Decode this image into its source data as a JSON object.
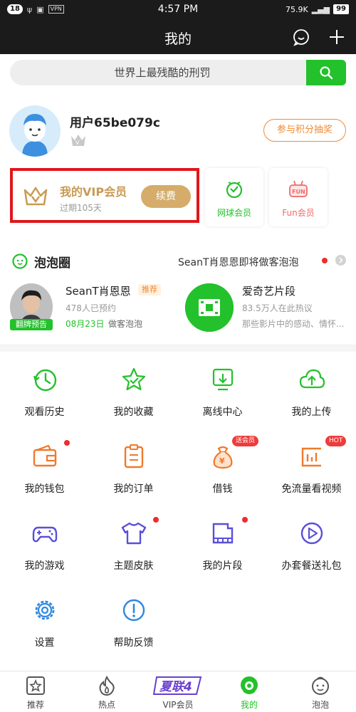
{
  "status_bar": {
    "notif_count": "18",
    "time": "4:57 PM",
    "vpn": "VPN",
    "speed": "75.9K",
    "battery": "99"
  },
  "header": {
    "title": "我的"
  },
  "search": {
    "placeholder": "世界上最残酷的刑罚"
  },
  "profile": {
    "username": "用户65be079c",
    "lottery_label": "参与积分抽奖"
  },
  "vip": {
    "title": "我的VIP会员",
    "subtitle": "过期105天",
    "renew_label": "续费"
  },
  "memberships": [
    {
      "label": "网球会员",
      "color": "#23c12b"
    },
    {
      "label": "Fun会员",
      "color": "#f06a6a"
    }
  ],
  "paopao": {
    "title": "泡泡圈",
    "news": "SeanT肖恩恩即将做客泡泡",
    "items": [
      {
        "name": "SeanT肖恩恩",
        "tag": "推荐",
        "count": "478人已预约",
        "date": "08月23日",
        "date_suffix": "做客泡泡",
        "badge": "翻牌预告"
      },
      {
        "name": "爱奇艺片段",
        "count": "83.5万人在此热议",
        "desc": "那些影片中的感动、情怀..."
      }
    ]
  },
  "grid": [
    {
      "label": "观看历史",
      "icon": "history-icon"
    },
    {
      "label": "我的收藏",
      "icon": "star-icon"
    },
    {
      "label": "离线中心",
      "icon": "download-icon"
    },
    {
      "label": "我的上传",
      "icon": "upload-icon"
    },
    {
      "label": "我的钱包",
      "icon": "wallet-icon"
    },
    {
      "label": "我的订单",
      "icon": "order-icon"
    },
    {
      "label": "借钱",
      "icon": "money-bag-icon",
      "badge": "送会员"
    },
    {
      "label": "免流量看视频",
      "icon": "chart-icon",
      "badge": "HOT"
    },
    {
      "label": "我的游戏",
      "icon": "gamepad-icon"
    },
    {
      "label": "主题皮肤",
      "icon": "shirt-icon"
    },
    {
      "label": "我的片段",
      "icon": "film-icon"
    },
    {
      "label": "办套餐送礼包",
      "icon": "play-icon"
    },
    {
      "label": "设置",
      "icon": "settings-icon"
    },
    {
      "label": "帮助反馈",
      "icon": "help-icon"
    }
  ],
  "tabs": [
    {
      "label": "推荐"
    },
    {
      "label": "热点"
    },
    {
      "label": "VIP会员",
      "logo_text": "夏联4"
    },
    {
      "label": "我的",
      "active": true
    },
    {
      "label": "泡泡"
    }
  ],
  "colors": {
    "accent_green": "#23c12b",
    "vip_gold": "#d5ac6a",
    "highlight_red": "#e0161c",
    "orange": "#f08a33",
    "icon_blue": "#2f87e0",
    "icon_orange": "#f07a2b",
    "icon_purple": "#5a4fd8"
  }
}
